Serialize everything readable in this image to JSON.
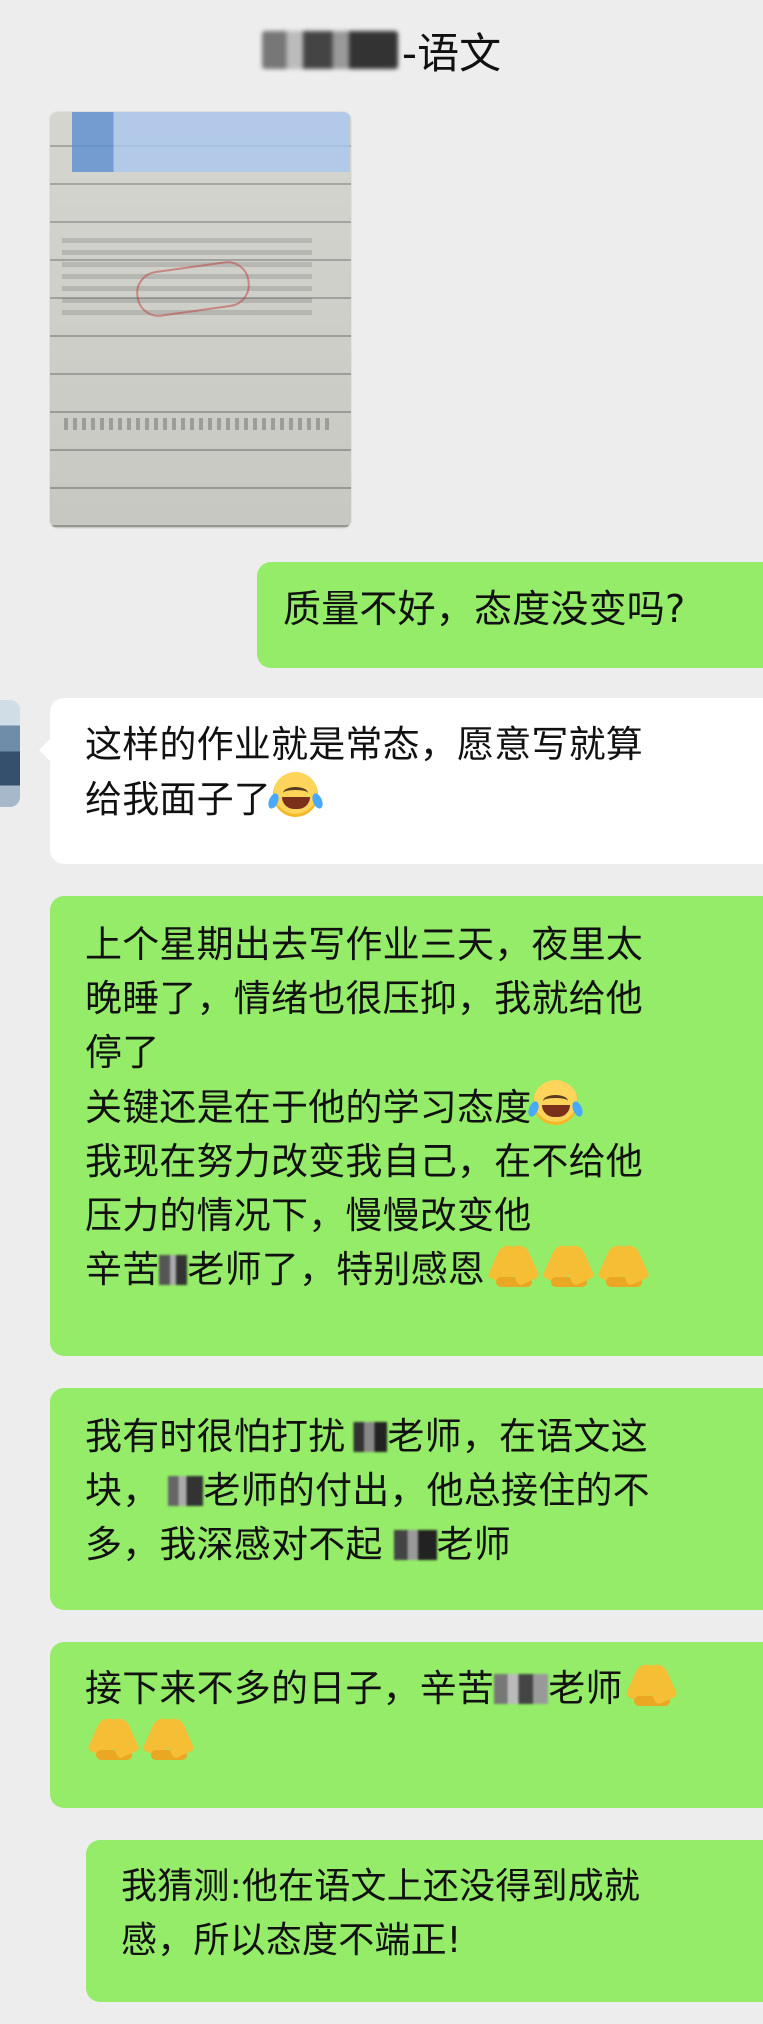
{
  "header": {
    "title_suffix": "-语文"
  },
  "messages": [
    {
      "type": "image",
      "sender": "other",
      "image_description": "homework workbook photo"
    },
    {
      "type": "text",
      "sender": "me",
      "text": "质量不好，态度没变吗?"
    },
    {
      "type": "text",
      "sender": "other",
      "lines": [
        "这样的作业就是常态，愿意写就算",
        "给我面子了"
      ],
      "emoji": [
        "face-with-tears-of-joy"
      ]
    },
    {
      "type": "text",
      "sender": "me",
      "lines": [
        "上个星期出去写作业三天，夜里太",
        "晚睡了，情绪也很压抑，我就给他",
        "停了",
        "关键还是在于他的学习态度",
        "我现在努力改变我自己，在不给他",
        "压力的情况下，慢慢改变他",
        "辛苦",
        "老师了，特别感恩"
      ],
      "emoji": [
        "face-with-tears-of-joy",
        "folded-hands",
        "folded-hands",
        "folded-hands"
      ]
    },
    {
      "type": "text",
      "sender": "me",
      "segments": [
        "我有时很怕打扰",
        "老师，在语文这",
        "块，",
        "老师的付出，他总接住的不",
        "多，我深感对不起",
        "老师"
      ]
    },
    {
      "type": "text",
      "sender": "me",
      "segments": [
        "接下来不多的日子，辛苦",
        "老师"
      ],
      "emoji": [
        "folded-hands",
        "folded-hands",
        "folded-hands"
      ]
    },
    {
      "type": "text",
      "sender": "me",
      "lines": [
        "我猜测:他在语文上还没得到成就",
        "感，所以态度不端正!"
      ]
    }
  ],
  "colors": {
    "background": "#ededed",
    "green_bubble": "#95ec69",
    "white_bubble": "#ffffff",
    "text": "#111111"
  }
}
